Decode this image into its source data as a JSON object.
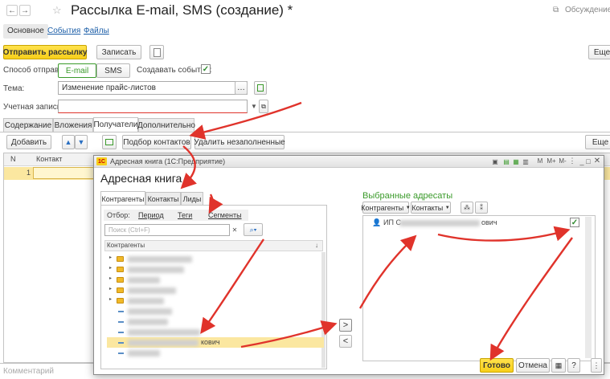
{
  "window": {
    "title": "Рассылка E-mail, SMS (создание) *",
    "discussion_label": "Обсуждение",
    "nav_tabs": [
      "Основное",
      "События",
      "Файлы"
    ]
  },
  "toolbar": {
    "send_label": "Отправить рассылку",
    "save_label": "Записать",
    "more_label": "Еще"
  },
  "form": {
    "send_method_label": "Способ отправки:",
    "method_email": "E-mail",
    "method_sms": "SMS",
    "create_events_label": "Создавать события:",
    "create_events_checked": true,
    "subject_label": "Тема:",
    "subject_value": "Изменение прайс-листов",
    "account_label": "Учетная запись:",
    "account_value": ""
  },
  "content_tabs": [
    "Содержание",
    "Вложения",
    "Получатели",
    "Дополнительно"
  ],
  "recipients": {
    "add_label": "Добавить",
    "pick_contacts_label": "Подбор контактов",
    "delete_empty_label": "Удалить незаполненные",
    "more_label": "Еще",
    "col_n": "N",
    "col_contact": "Контакт",
    "rows": [
      {
        "n": "1",
        "contact": ""
      }
    ]
  },
  "comment_placeholder": "Комментарий",
  "dialog": {
    "window_title": "Адресная книга (1С:Предприятие)",
    "heading": "Адресная книга",
    "tabs": [
      "Контрагенты",
      "Контакты",
      "Лиды"
    ],
    "filter_label": "Отбор:",
    "filter_links": [
      "Период",
      "Теги",
      "Сегменты"
    ],
    "search_placeholder": "Поиск (Ctrl+F)",
    "tree_header": "Контрагенты",
    "tree_visible_text": "кович",
    "selected_heading": "Выбранные адресаты",
    "selected_buttons": [
      "Контрагенты",
      "Контакты"
    ],
    "selected_row_prefix": "ИП С",
    "selected_row_suffix": "ович",
    "selected_row_checked": true,
    "ok_label": "Готово",
    "cancel_label": "Отмена",
    "help_label": "?",
    "move_right": ">",
    "move_left": "<"
  },
  "colors": {
    "accent_yellow": "#f7cf1a",
    "heading_green": "#3a9a2a",
    "arrow_red": "#e0332b",
    "selection_yellow": "#fbe7a0"
  }
}
